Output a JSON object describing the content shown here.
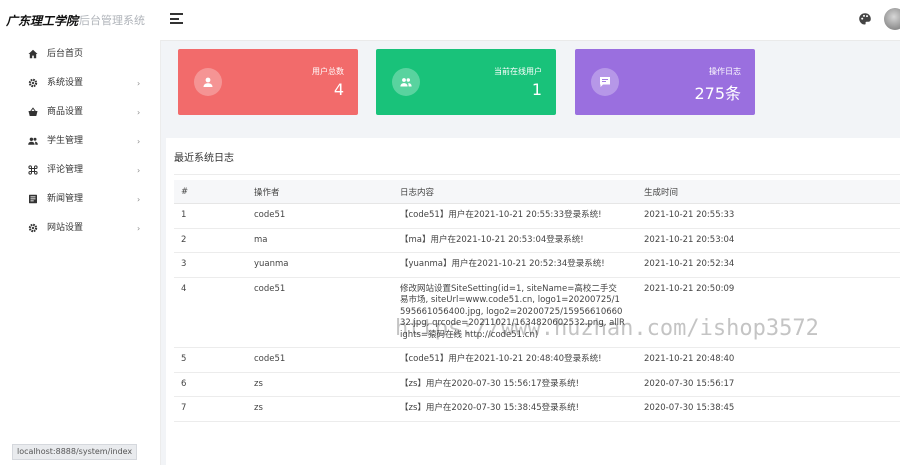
{
  "header": {
    "school_name": "广东理工学院",
    "system_name": "后台管理系统"
  },
  "sidebar": {
    "items": [
      {
        "label": "后台首页",
        "icon": "home-icon"
      },
      {
        "label": "系统设置",
        "icon": "gear-icon",
        "arrow": "›"
      },
      {
        "label": "商品设置",
        "icon": "basket-icon",
        "arrow": "›"
      },
      {
        "label": "学生管理",
        "icon": "users-icon",
        "arrow": "›"
      },
      {
        "label": "评论管理",
        "icon": "command-icon",
        "arrow": "›"
      },
      {
        "label": "新闻管理",
        "icon": "news-icon",
        "arrow": "›"
      },
      {
        "label": "网站设置",
        "icon": "gear-icon",
        "arrow": "›"
      }
    ]
  },
  "stats": [
    {
      "label": "用户总数",
      "value": "4",
      "color": "#f26b6b",
      "icon": "user-icon"
    },
    {
      "label": "当前在线用户",
      "value": "1",
      "color": "#19c27a",
      "icon": "users-icon"
    },
    {
      "label": "操作日志",
      "value": "275条",
      "color": "#9a6fdf",
      "icon": "message-icon"
    }
  ],
  "logs": {
    "title": "最近系统日志",
    "columns": [
      "#",
      "操作者",
      "日志内容",
      "生成时间"
    ],
    "rows": [
      {
        "id": "1",
        "operator": "code51",
        "content": "【code51】用户在2021-10-21 20:55:33登录系统!",
        "time": "2021-10-21 20:55:33"
      },
      {
        "id": "2",
        "operator": "ma",
        "content": "【ma】用户在2021-10-21 20:53:04登录系统!",
        "time": "2021-10-21 20:53:04"
      },
      {
        "id": "3",
        "operator": "yuanma",
        "content": "【yuanma】用户在2021-10-21 20:52:34登录系统!",
        "time": "2021-10-21 20:52:34"
      },
      {
        "id": "4",
        "operator": "code51",
        "content": "修改网站设置SiteSetting(id=1, siteName=高校二手交易市场, siteUrl=www.code51.cn, logo1=20200725/1595661056400.jpg, logo2=20200725/1595661066032.jpg, qrcode=20211021/1634820602532.png, allRights=猿码在线 http://code51.cn)",
        "time": "2021-10-21 20:50:09"
      },
      {
        "id": "5",
        "operator": "code51",
        "content": "【code51】用户在2021-10-21 20:48:40登录系统!",
        "time": "2021-10-21 20:48:40"
      },
      {
        "id": "6",
        "operator": "zs",
        "content": "【zs】用户在2020-07-30 15:56:17登录系统!",
        "time": "2020-07-30 15:56:17"
      },
      {
        "id": "7",
        "operator": "zs",
        "content": "【zs】用户在2020-07-30 15:38:45登录系统!",
        "time": "2020-07-30 15:38:45"
      }
    ]
  },
  "watermark": "https://www.huzhan.com/ishop3572",
  "status_url": "localhost:8888/system/index"
}
